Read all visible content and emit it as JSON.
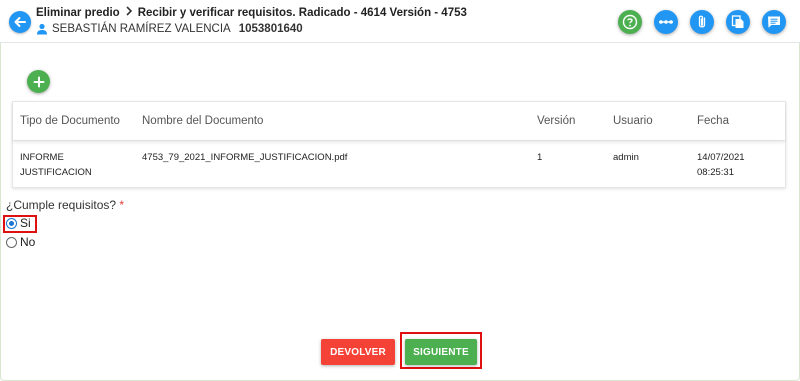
{
  "header": {
    "breadcrumb": [
      "Eliminar predio",
      "Recibir y verificar requisitos. Radicado - 4614 Versión - 4753"
    ],
    "user_name": "SEBASTIÁN RAMÍREZ VALENCIA",
    "user_doc": "1053801640",
    "tools": [
      "help-icon",
      "flow-icon",
      "attachment-icon",
      "copy-icon",
      "comments-icon"
    ]
  },
  "table": {
    "headers": [
      "Tipo de Documento",
      "Nombre del Documento",
      "Versión",
      "Usuario",
      "Fecha"
    ],
    "rows": [
      {
        "tipo": [
          "INFORME",
          "JUSTIFICACION"
        ],
        "nombre": "4753_79_2021_INFORME_JUSTIFICACION.pdf",
        "version": "1",
        "usuario": "admin",
        "fecha": [
          "14/07/2021",
          "08:25:31"
        ]
      }
    ]
  },
  "form": {
    "question": "¿Cumple requisitos?",
    "required_mark": "*",
    "options": [
      {
        "label": "Si",
        "selected": true
      },
      {
        "label": "No",
        "selected": false
      }
    ]
  },
  "actions": {
    "devolver": "DEVOLVER",
    "siguiente": "SIGUIENTE"
  },
  "colors": {
    "primary": "#2196f3",
    "success": "#4caf50",
    "danger": "#f44336",
    "highlight": "#e01010"
  }
}
